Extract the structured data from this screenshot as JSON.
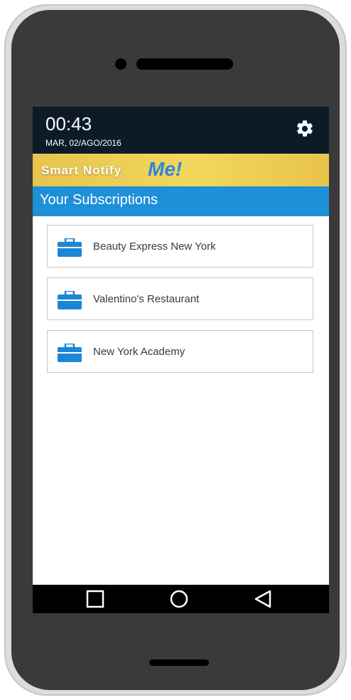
{
  "status_bar": {
    "time": "00:43",
    "date": "MAR, 02/AGO/2016"
  },
  "brand": {
    "name": "Smart Notify",
    "accent": "Me!",
    "colors": {
      "banner": "#f1d75e",
      "accent": "#2e86d8"
    }
  },
  "header": {
    "title": "Your Subscriptions",
    "color": "#1e90d8"
  },
  "subscriptions": [
    {
      "label": "Beauty Express New York",
      "icon": "briefcase-icon"
    },
    {
      "label": "Valentino's Restaurant",
      "icon": "briefcase-icon"
    },
    {
      "label": "New York Academy",
      "icon": "briefcase-icon"
    }
  ],
  "nav": {
    "buttons": [
      "recents-square-icon",
      "home-circle-icon",
      "back-triangle-icon"
    ]
  },
  "icons": {
    "settings": "gear-icon"
  }
}
